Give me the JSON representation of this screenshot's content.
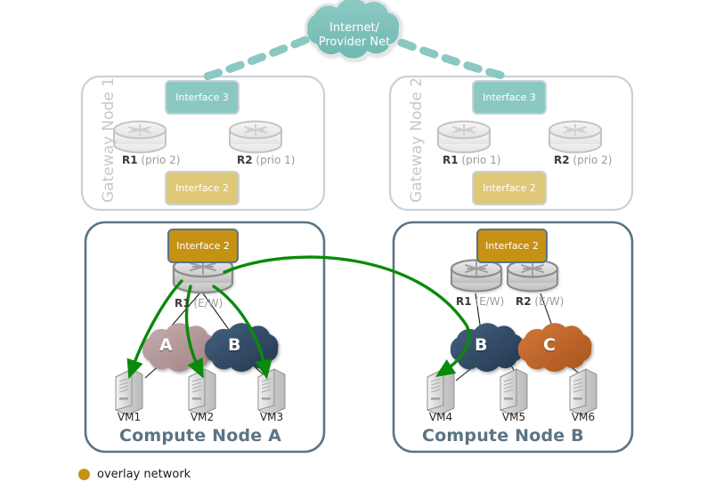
{
  "diagram": {
    "title": "OpenStack routed overlay network topology",
    "colors": {
      "teal": "#7fc3bd",
      "teal_faded": "#8cc8c3",
      "gold": "#c69214",
      "gold_faded": "#dfc877",
      "panel_border_strong": "#5b7484",
      "panel_border_faded": "#c9d2d6",
      "title_strong": "#5b7484",
      "title_faded": "#c2c9cc",
      "overlay_line": "#0a8a0a",
      "cloud_a": "#b79a9c",
      "cloud_b": "#3e5878",
      "cloud_c": "#c1692a",
      "router_body": "#d8d8d8",
      "router_stroke": "#8d8d8d",
      "vm_body": "#d9dbd9",
      "link_line": "#1a1a1a"
    },
    "internet_cloud": {
      "label": "Internet/\nProvider Net",
      "fill": "#7fc3bd"
    },
    "connections": {
      "internet_to_gw1": "dashed-teal",
      "internet_to_gw2": "dashed-teal",
      "overlay_a_to_b": "green-curve"
    },
    "gateway_nodes": [
      {
        "title": "Gateway Node 1",
        "interface_top": {
          "label": "Interface 3",
          "color": "#8cc8c3"
        },
        "interface_bottom": {
          "label": "Interface 2",
          "color": "#dfc877"
        },
        "routers": [
          {
            "name": "R1",
            "note": "(prio 2)"
          },
          {
            "name": "R2",
            "note": "(prio 1)"
          }
        ]
      },
      {
        "title": "Gateway Node 2",
        "interface_top": {
          "label": "Interface 3",
          "color": "#8cc8c3"
        },
        "interface_bottom": {
          "label": "Interface 2",
          "color": "#dfc877"
        },
        "routers": [
          {
            "name": "R1",
            "note": "(prio 1)"
          },
          {
            "name": "R2",
            "note": "(prio 2)"
          }
        ]
      }
    ],
    "compute_nodes": [
      {
        "title": "Compute Node A",
        "interface_top": {
          "label": "Interface 2",
          "color": "#c69214"
        },
        "routers": [
          {
            "name": "R1",
            "note": "(E/W)"
          }
        ],
        "clouds": [
          {
            "letter": "A",
            "color": "#b79a9c"
          },
          {
            "letter": "B",
            "color": "#3e5878"
          }
        ],
        "vms": [
          {
            "label": "VM1"
          },
          {
            "label": "VM2"
          },
          {
            "label": "VM3"
          }
        ]
      },
      {
        "title": "Compute Node B",
        "interface_top": {
          "label": "Interface 2",
          "color": "#c69214"
        },
        "routers": [
          {
            "name": "R1",
            "note": "(E/W)"
          },
          {
            "name": "R2",
            "note": "(E/W)"
          }
        ],
        "clouds": [
          {
            "letter": "B",
            "color": "#3e5878"
          },
          {
            "letter": "C",
            "color": "#c1692a"
          }
        ],
        "vms": [
          {
            "label": "VM4"
          },
          {
            "label": "VM5"
          },
          {
            "label": "VM6"
          }
        ]
      }
    ],
    "legend": [
      {
        "label": "overlay network",
        "color": "#c69214"
      }
    ]
  }
}
